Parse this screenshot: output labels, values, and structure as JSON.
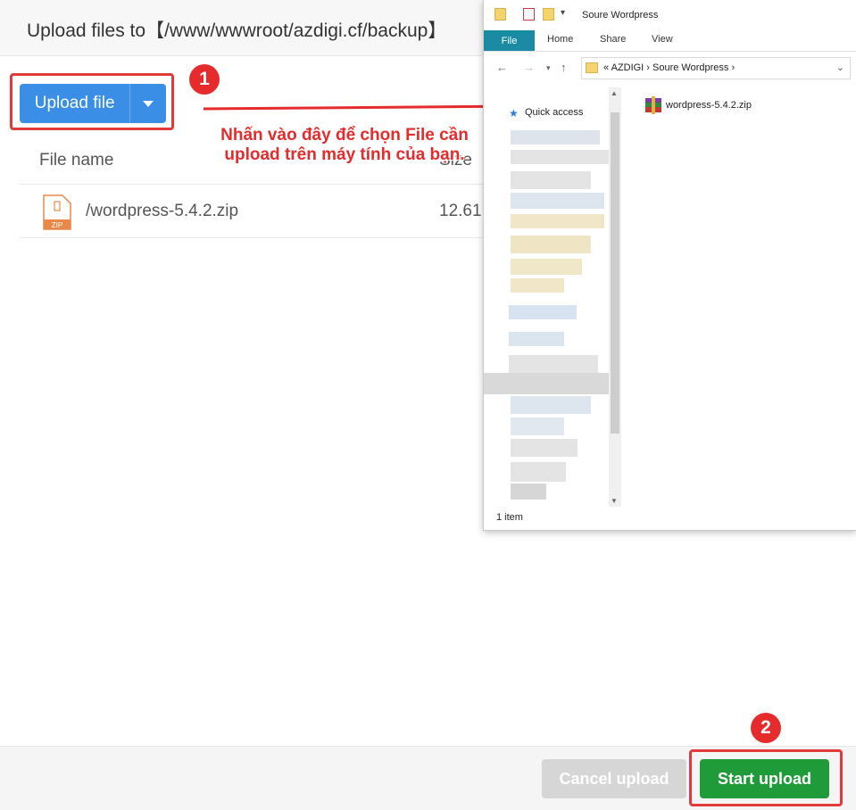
{
  "dialog": {
    "title": "Upload files to【/www/wwwroot/azdigi.cf/backup】",
    "upload_button": "Upload file",
    "columns": {
      "name": "File name",
      "size": "Size"
    },
    "files": [
      {
        "name": "/wordpress-5.4.2.zip",
        "size": "12.61",
        "icon_label": "ZIP"
      }
    ],
    "cancel_button": "Cancel upload",
    "start_button": "Start upload"
  },
  "annotations": {
    "step1": "1",
    "step2": "2",
    "instruction": "Nhấn vào đây để chọn File cần upload trên máy tính của bạn.",
    "color": "#e52b2b"
  },
  "explorer": {
    "title": "Soure Wordpress",
    "ribbon_tabs": [
      "File",
      "Home",
      "Share",
      "View"
    ],
    "address_path": "«   AZDIGI  ›  Soure Wordpress  ›",
    "nav": {
      "quick_access": "Quick access"
    },
    "files": [
      {
        "name": "wordpress-5.4.2.zip"
      }
    ],
    "status": "1 item"
  }
}
